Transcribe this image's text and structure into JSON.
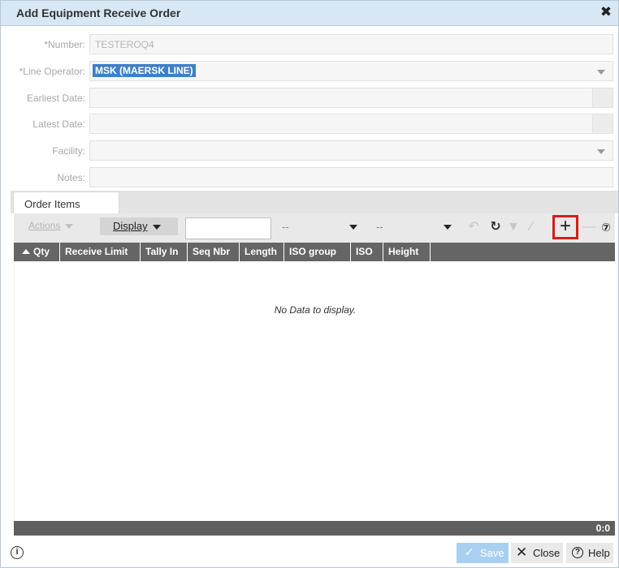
{
  "dialog": {
    "title": "Add Equipment Receive Order",
    "close_glyph": "✖"
  },
  "form": {
    "number": {
      "label": "*Number:",
      "value": "TESTEROQ4"
    },
    "line_operator": {
      "label": "*Line Operator:",
      "value": "MSK (MAERSK LINE)"
    },
    "earliest_date": {
      "label": "Earliest Date:",
      "value": ""
    },
    "latest_date": {
      "label": "Latest Date:",
      "value": ""
    },
    "facility": {
      "label": "Facility:",
      "value": ""
    },
    "notes": {
      "label": "Notes:",
      "value": ""
    }
  },
  "tabs": [
    {
      "label": "Order Items"
    }
  ],
  "toolbar": {
    "actions_label": "Actions",
    "display_label": "Display",
    "search_value": "",
    "filter1_value": "--",
    "filter2_value": "--",
    "icons": [
      "undo-icon",
      "refresh-icon",
      "filter-icon",
      "edit-icon",
      "add-icon",
      "remove-icon",
      "help-icon"
    ]
  },
  "grid": {
    "columns": [
      "Qty",
      "Receive Limit",
      "Tally In",
      "Seq Nbr",
      "Length",
      "ISO group",
      "ISO",
      "Height"
    ],
    "empty_message": "No Data to display.",
    "count": "0:0"
  },
  "footer": {
    "save_label": "Save",
    "close_label": "Close",
    "help_label": "Help"
  },
  "colors": {
    "title_bar": "#d7e7f4",
    "grid_header": "#656565",
    "selection": "#3f7fc6",
    "highlight": "#d21e1e",
    "save_disabled": "#a9d0f0"
  }
}
